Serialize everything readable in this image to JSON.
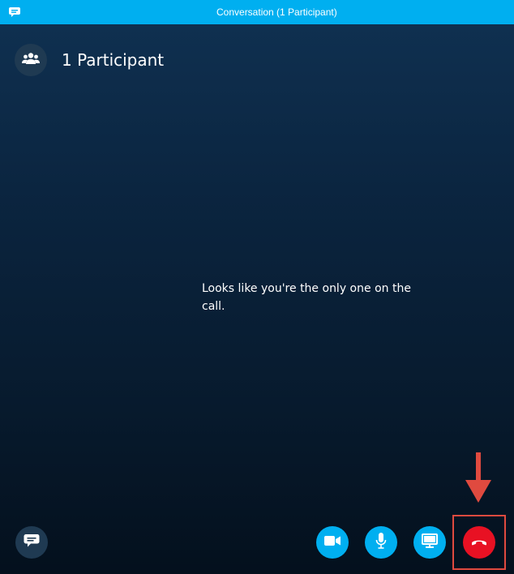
{
  "window": {
    "title": "Conversation (1 Participant)",
    "app_icon": "skype-chat-icon"
  },
  "header": {
    "participants_icon": "people-icon",
    "participants_label": "1 Participant"
  },
  "main": {
    "message": "Looks like you're the only one on the call."
  },
  "controls": {
    "chat_icon": "chat-icon",
    "video_icon": "video-camera-icon",
    "mic_icon": "microphone-icon",
    "share_icon": "screen-share-icon",
    "end_call_icon": "hang-up-icon"
  },
  "colors": {
    "titlebar": "#00aff0",
    "accent": "#00aff0",
    "end_call": "#e81123",
    "annotation": "#e04a3f"
  }
}
